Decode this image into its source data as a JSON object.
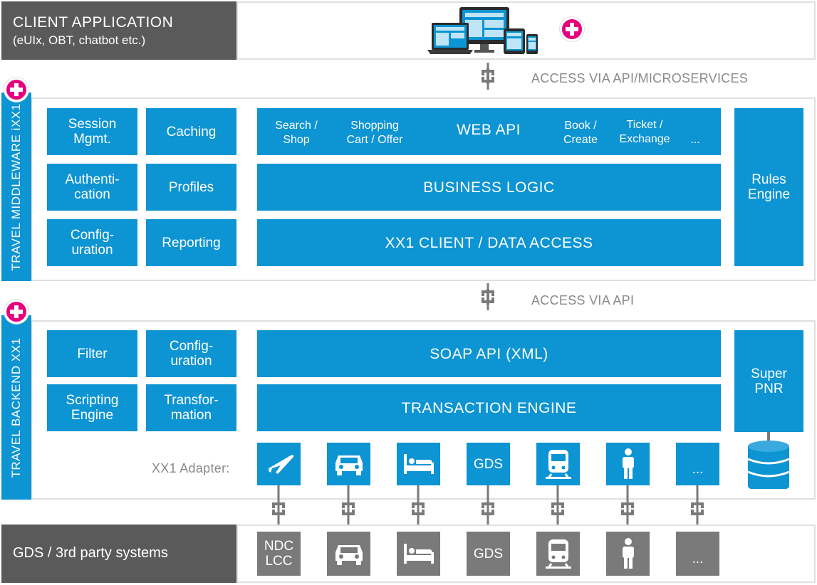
{
  "colors": {
    "blue": "#0d94d3",
    "magenta": "#e6007e",
    "dark_gray": "#5a5a5a",
    "gray": "#7a7a7a",
    "label_gray": "#8a8a8a"
  },
  "client": {
    "title": "CLIENT APPLICATION",
    "subtitle": "(eUIx, OBT, chatbot etc.)",
    "icon": "devices-icon"
  },
  "access_microservices": "ACCESS VIA API/MICROSERVICES",
  "access_api": "ACCESS VIA API",
  "middleware": {
    "title": "TRAVEL MIDDLEWARE iXX1",
    "left_boxes": [
      "Session\nMgmt.",
      "Caching",
      "Authenti-\ncation",
      "Profiles",
      "Config-\nuration",
      "Reporting"
    ],
    "web_api": {
      "title": "WEB API",
      "items": [
        "Search /\nShop",
        "Shopping\nCart / Offer",
        "Book /\nCreate",
        "Ticket /\nExchange",
        "..."
      ]
    },
    "business_logic": "BUSINESS LOGIC",
    "client_access": "XX1 CLIENT / DATA ACCESS",
    "rules_engine": "Rules\nEngine"
  },
  "backend": {
    "title": "TRAVEL BACKEND XX1",
    "left_boxes": [
      "Filter",
      "Config-\nuration",
      "Scripting\nEngine",
      "Transfor-\nmation"
    ],
    "soap_api": "SOAP API (XML)",
    "transaction_engine": "TRANSACTION ENGINE",
    "super_pnr": "Super\nPNR",
    "adapter_label": "XX1 Adapter:",
    "adapters": [
      {
        "icon": "airplane-icon",
        "text": ""
      },
      {
        "icon": "car-icon",
        "text": ""
      },
      {
        "icon": "bed-icon",
        "text": ""
      },
      {
        "icon": "",
        "text": "GDS"
      },
      {
        "icon": "train-icon",
        "text": ""
      },
      {
        "icon": "person-icon",
        "text": ""
      },
      {
        "icon": "",
        "text": "..."
      }
    ],
    "database_icon": "database-icon"
  },
  "gds": {
    "title": "GDS / 3rd party systems",
    "systems": [
      {
        "icon": "",
        "text": "NDC\nLCC"
      },
      {
        "icon": "car-icon",
        "text": ""
      },
      {
        "icon": "bed-icon",
        "text": ""
      },
      {
        "icon": "",
        "text": "GDS"
      },
      {
        "icon": "train-icon",
        "text": ""
      },
      {
        "icon": "person-icon",
        "text": ""
      },
      {
        "icon": "",
        "text": "..."
      }
    ]
  }
}
